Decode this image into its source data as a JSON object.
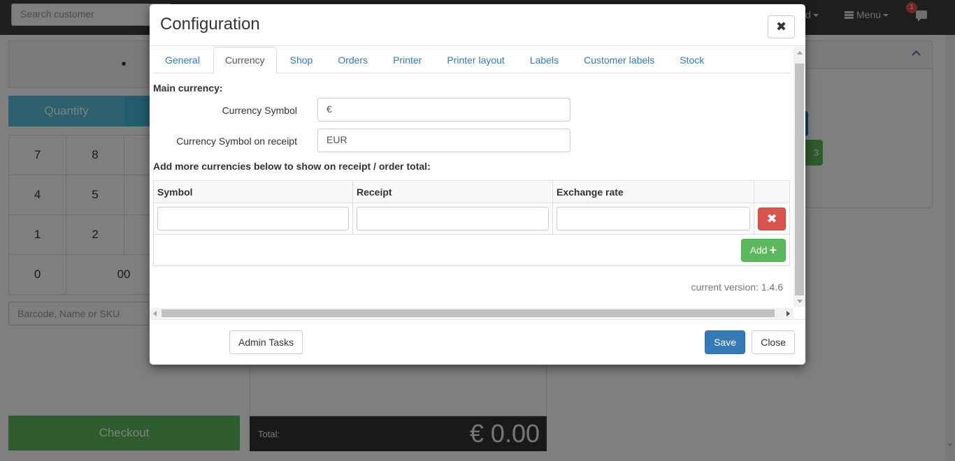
{
  "background": {
    "search_placeholder": "Search customer",
    "nav_partial_text": "d",
    "menu_label": "Menu",
    "chat_badge_count": "1",
    "display_value": "•",
    "quantity_label": "Quantity",
    "keypad": [
      [
        "7",
        "8",
        ""
      ],
      [
        "4",
        "5",
        ""
      ],
      [
        "1",
        "2",
        ""
      ],
      [
        "0",
        "00",
        ""
      ]
    ],
    "barcode_placeholder": "Barcode, Name or SKU",
    "checkout_label": "Checkout",
    "total_label": "Total:",
    "total_value": "€ 0.00",
    "right_btn_text": "3"
  },
  "modal": {
    "title": "Configuration",
    "close_symbol": "✖",
    "tabs": [
      {
        "label": "General",
        "active": false
      },
      {
        "label": "Currency",
        "active": true
      },
      {
        "label": "Shop",
        "active": false
      },
      {
        "label": "Orders",
        "active": false
      },
      {
        "label": "Printer",
        "active": false
      },
      {
        "label": "Printer layout",
        "active": false
      },
      {
        "label": "Labels",
        "active": false
      },
      {
        "label": "Customer labels",
        "active": false
      },
      {
        "label": "Stock",
        "active": false
      }
    ],
    "main_currency_heading": "Main currency:",
    "fields": {
      "currency_symbol_label": "Currency Symbol",
      "currency_symbol_value": "€",
      "receipt_symbol_label": "Currency Symbol on receipt",
      "receipt_symbol_value": "EUR"
    },
    "more_currencies_heading": "Add more currencies below to show on receipt / order total:",
    "table": {
      "headers": [
        "Symbol",
        "Receipt",
        "Exchange rate",
        ""
      ],
      "rows": [
        {
          "symbol": "",
          "receipt": "",
          "exchange_rate": ""
        }
      ],
      "delete_symbol": "✖",
      "add_label": "Add",
      "add_symbol": "+"
    },
    "version_text": "current version: 1.4.6",
    "footer": {
      "admin_tasks_label": "Admin Tasks",
      "save_label": "Save",
      "close_label": "Close"
    }
  }
}
